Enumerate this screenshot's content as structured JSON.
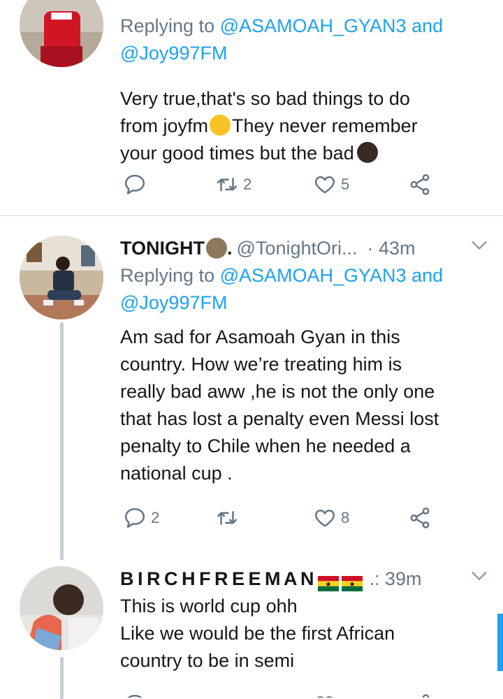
{
  "tweets": [
    {
      "reply_prefix": "Replying to ",
      "mention1": "@ASAMOAH_GYAN3",
      "and": " and",
      "mention2": "@Joy997FM",
      "text_lines": [
        "Very true,that's so bad things to do",
        "from joyfm",
        "They never remember",
        "your good times but the bad"
      ],
      "reply_count": "",
      "retweet_count": "2",
      "like_count": "5"
    },
    {
      "name": "TONIGHT",
      "name_suffix": ".",
      "handle": "@TonightOri...",
      "time": "· 43m",
      "reply_prefix": "Replying to ",
      "mention1": "@ASAMOAH_GYAN3",
      "and": " and",
      "mention2": "@Joy997FM",
      "text_lines": [
        "Am sad for Asamoah Gyan in this",
        "country. How we’re treating him is",
        "really bad aww ,he is not the only one",
        "that has lost a penalty even Messi lost",
        "penalty to Chile when he needed a",
        "national cup ."
      ],
      "reply_count": "2",
      "retweet_count": "",
      "like_count": "8"
    },
    {
      "name": "B I R C H F R E E M A N",
      "handle": "..",
      "time": ".: 39m",
      "text_lines": [
        "This is world cup ohh",
        "Like we would be the first African",
        "country to be in semi"
      ]
    }
  ],
  "icons": {
    "reply": "reply-icon",
    "retweet": "retweet-icon",
    "like": "heart-icon",
    "share": "share-icon",
    "more": "chevron-down-icon"
  },
  "colors": {
    "link": "#1da1f2",
    "secondary": "#657786",
    "text": "#14171a",
    "thread_line": "#c4cfd6"
  }
}
